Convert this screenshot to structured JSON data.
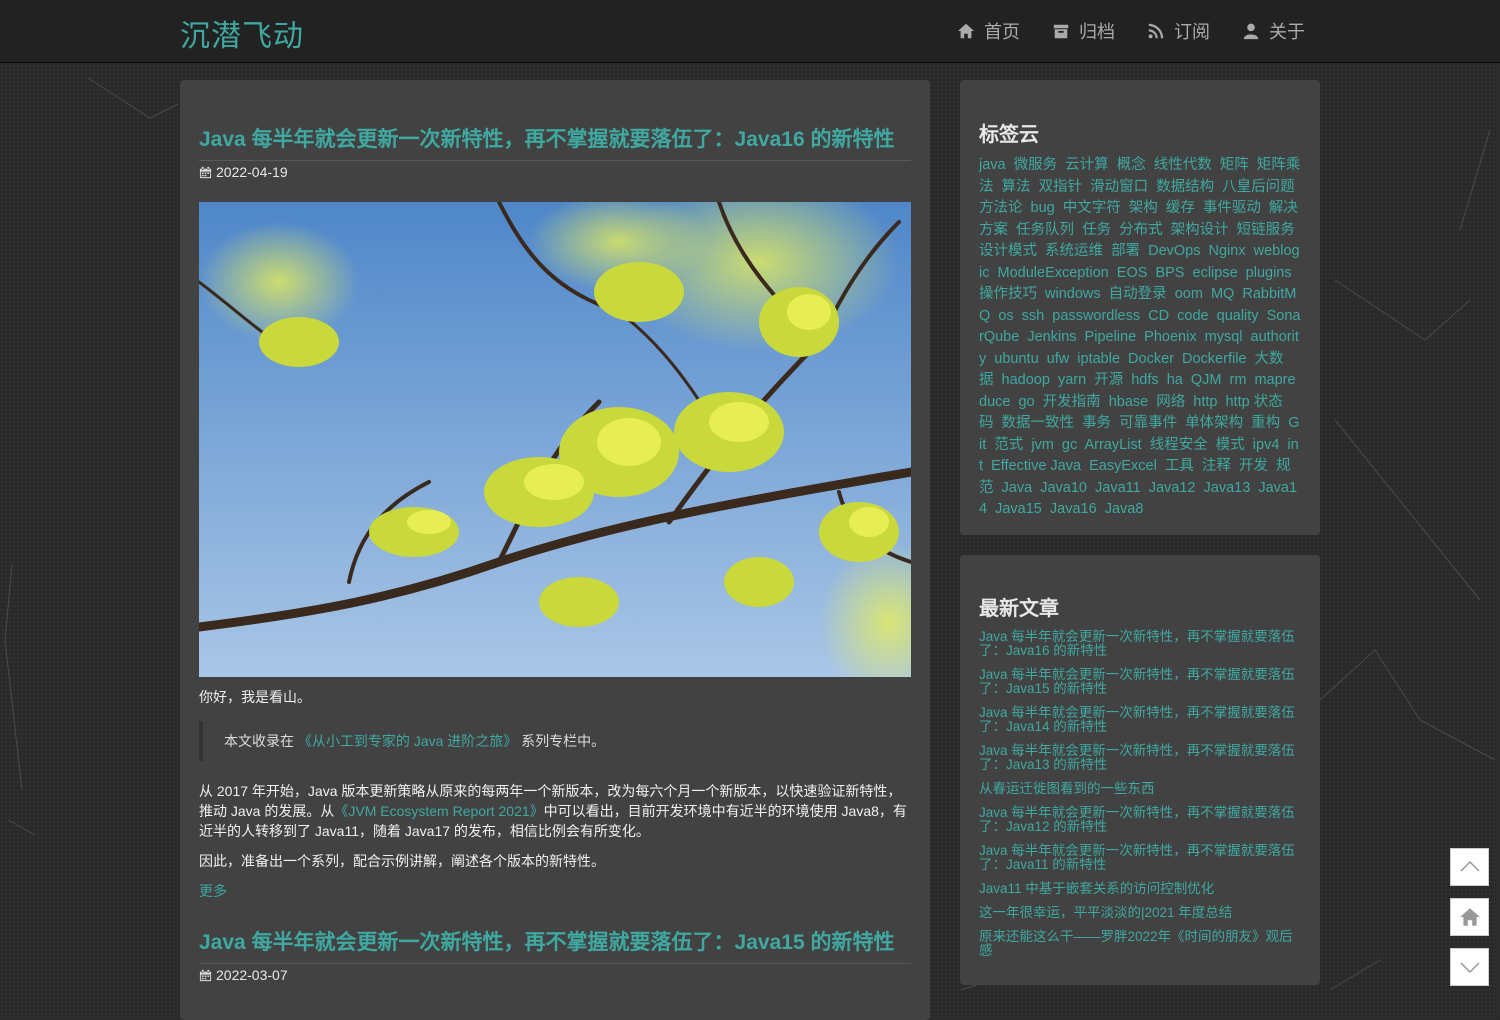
{
  "site": {
    "brand": "沉潜飞动"
  },
  "nav": [
    {
      "label": "首页",
      "icon": "home-icon"
    },
    {
      "label": "归档",
      "icon": "archive-icon"
    },
    {
      "label": "订阅",
      "icon": "rss-icon"
    },
    {
      "label": "关于",
      "icon": "user-icon"
    }
  ],
  "posts": [
    {
      "title": "Java 每半年就会更新一次新特性，再不掌握就要落伍了：Java16 的新特性",
      "date": "2022-04-19",
      "greeting": "你好，我是看山。",
      "quote_prefix": "本文收录在",
      "quote_link": "《从小工到专家的 Java 进阶之旅》",
      "quote_suffix": "系列专栏中。",
      "para1_a": "从 2017 年开始，Java 版本更新策略从原来的每两年一个新版本，改为每六个月一个新版本，以快速验证新特性，推动 Java 的发展。从",
      "para1_link": "《JVM Ecosystem Report 2021》",
      "para1_b": "中可以看出，目前开发环境中有近半的环境使用 Java8，有近半的人转移到了 Java11，随着 Java17 的发布，相信比例会有所变化。",
      "para2": "因此，准备出一个系列，配合示例讲解，阐述各个版本的新特性。",
      "more": "更多"
    },
    {
      "title": "Java 每半年就会更新一次新特性，再不掌握就要落伍了：Java15 的新特性",
      "date": "2022-03-07"
    }
  ],
  "tag_cloud": {
    "title": "标签云",
    "tags": [
      "java",
      "微服务",
      "云计算",
      "概念",
      "线性代数",
      "矩阵",
      "矩阵乘法",
      "算法",
      "双指针",
      "滑动窗口",
      "数据结构",
      "八皇后问题",
      "方法论",
      "bug",
      "中文字符",
      "架构",
      "缓存",
      "事件驱动",
      "解决方案",
      "任务队列",
      "任务",
      "分布式",
      "架构设计",
      "短链服务",
      "设计模式",
      "系统运维",
      "部署",
      "DevOps",
      "Nginx",
      "weblogic",
      "ModuleException",
      "EOS",
      "BPS",
      "eclipse",
      "plugins",
      "操作技巧",
      "windows",
      "自动登录",
      "oom",
      "MQ",
      "RabbitMQ",
      "os",
      "ssh",
      "passwordless",
      "CD",
      "code",
      "quality",
      "SonarQube",
      "Jenkins",
      "Pipeline",
      "Phoenix",
      "mysql",
      "authority",
      "ubuntu",
      "ufw",
      "iptable",
      "Docker",
      "Dockerfile",
      "大数据",
      "hadoop",
      "yarn",
      "开源",
      "hdfs",
      "ha",
      "QJM",
      "rm",
      "mapreduce",
      "go",
      "开发指南",
      "hbase",
      "网络",
      "http",
      "http 状态码",
      "数据一致性",
      "事务",
      "可靠事件",
      "单体架构",
      "重构",
      "Git",
      "范式",
      "jvm",
      "gc",
      "ArrayList",
      "线程安全",
      "模式",
      "ipv4",
      "int",
      "Effective Java",
      "EasyExcel",
      "工具",
      "注释",
      "开发",
      "规范",
      "Java",
      "Java10",
      "Java11",
      "Java12",
      "Java13",
      "Java14",
      "Java15",
      "Java16",
      "Java8"
    ]
  },
  "recent": {
    "title": "最新文章",
    "items": [
      "Java 每半年就会更新一次新特性，再不掌握就要落伍了：Java16 的新特性",
      "Java 每半年就会更新一次新特性，再不掌握就要落伍了：Java15 的新特性",
      "Java 每半年就会更新一次新特性，再不掌握就要落伍了：Java14 的新特性",
      "Java 每半年就会更新一次新特性，再不掌握就要落伍了：Java13 的新特性",
      "从春运迁徙图看到的一些东西",
      "Java 每半年就会更新一次新特性，再不掌握就要落伍了：Java12 的新特性",
      "Java 每半年就会更新一次新特性，再不掌握就要落伍了：Java11 的新特性",
      "Java11 中基于嵌套关系的访问控制优化",
      "这一年很幸运，平平淡淡的|2021 年度总结",
      "原来还能这么干——罗胖2022年《时间的朋友》观后感"
    ]
  },
  "float_buttons": [
    "scroll-top-icon",
    "home-icon",
    "scroll-bottom-icon"
  ]
}
